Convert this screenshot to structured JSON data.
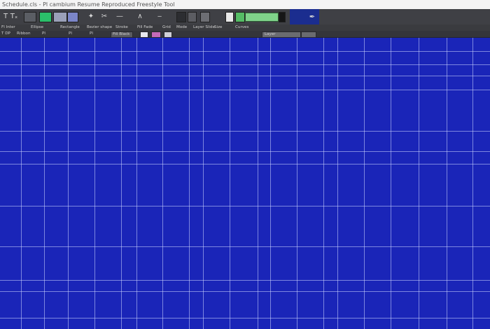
{
  "window": {
    "title": "Schedule.cls - Pl cambium Resume Reproduced  Freestyle Tool"
  },
  "toolbar": {
    "tools": [
      {
        "name": "text-tool-icon",
        "glyph": "T"
      },
      {
        "name": "font-size-tool-icon",
        "glyph": "Tₓ"
      },
      {
        "name": "image-tool-icon",
        "glyph": "▣"
      },
      {
        "name": "photo-tool-icon",
        "glyph": "▦"
      },
      {
        "name": "brush-tool-icon",
        "glyph": "✦"
      },
      {
        "name": "scissors-tool-icon",
        "glyph": "✂"
      },
      {
        "name": "eraser-tool-icon",
        "glyph": "❐"
      },
      {
        "name": "line-tool-icon",
        "glyph": "—"
      },
      {
        "name": "angle-tool-icon",
        "glyph": "∧"
      },
      {
        "name": "minus-tool-icon",
        "glyph": "‒"
      },
      {
        "name": "layer-tool-icon",
        "glyph": "▥"
      },
      {
        "name": "zoom-tool-icon",
        "glyph": "▢"
      },
      {
        "name": "pen-tool-icon",
        "glyph": "✒"
      }
    ],
    "accent_green": "#7fd38a",
    "panel_blue": "#1b2d8f"
  },
  "options_row1": {
    "items": [
      "Fl  Inter",
      "Ellipse",
      "Rectangle",
      "Bezier shape",
      "Stroke",
      "Fill  Fade",
      "Grid",
      "Mode",
      "Layer  Slide",
      "Size",
      "Curves"
    ]
  },
  "options_row2": {
    "items": [
      "T  DP",
      "Ribbon",
      "Pl",
      "Pl",
      "Pl",
      "Fill  Black",
      "Layer"
    ]
  },
  "canvas": {
    "background": "#1a25b8"
  }
}
